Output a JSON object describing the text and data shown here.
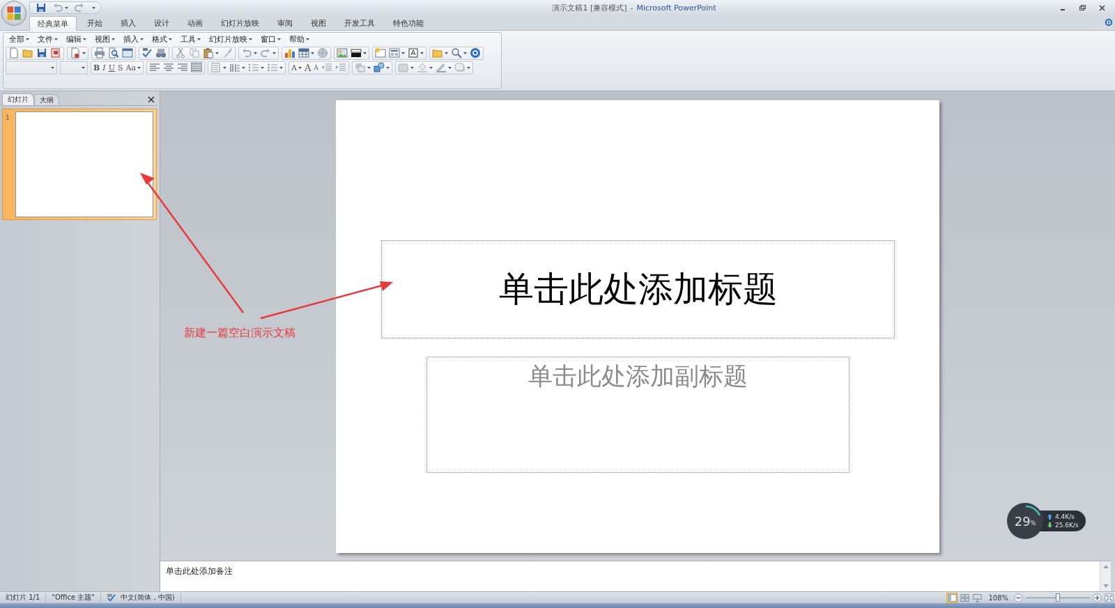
{
  "window": {
    "title": "演示文稿1 [兼容模式]",
    "separator": "-",
    "app": "Microsoft PowerPoint"
  },
  "ribbon_tabs": [
    {
      "label": "经典菜单",
      "selected": true
    },
    {
      "label": "开始",
      "selected": false
    },
    {
      "label": "插入",
      "selected": false
    },
    {
      "label": "设计",
      "selected": false
    },
    {
      "label": "动画",
      "selected": false
    },
    {
      "label": "幻灯片放映",
      "selected": false
    },
    {
      "label": "审阅",
      "selected": false
    },
    {
      "label": "视图",
      "selected": false
    },
    {
      "label": "开发工具",
      "selected": false
    },
    {
      "label": "特色功能",
      "selected": false
    }
  ],
  "menu_bar": [
    "全部",
    "文件",
    "编辑",
    "视图",
    "插入",
    "格式",
    "工具",
    "幻灯片放映",
    "窗口",
    "帮助"
  ],
  "format_buttons": [
    "B",
    "I",
    "U",
    "S",
    "Aa"
  ],
  "font_buttons": [
    "A",
    "A",
    "A"
  ],
  "left_pane": {
    "tabs": [
      {
        "label": "幻灯片",
        "selected": true
      },
      {
        "label": "大纲",
        "selected": false
      }
    ],
    "slides": [
      {
        "number": "1",
        "selected": true
      }
    ]
  },
  "slide": {
    "title_placeholder": "单击此处添加标题",
    "subtitle_placeholder": "单击此处添加副标题"
  },
  "annotation": {
    "text": "新建一篇空白演示文稿"
  },
  "notes": {
    "prompt": "单击此处添加备注"
  },
  "status_bar": {
    "slide_info": "幻灯片 1/1",
    "theme": "\"Office 主题\"",
    "language": "中文(简体，中国)",
    "views": [
      {
        "kind": "normal",
        "selected": true
      },
      {
        "kind": "sorter",
        "selected": false
      },
      {
        "kind": "show",
        "selected": false
      }
    ],
    "zoom": "108%",
    "level": 0.5
  },
  "network_widget": {
    "cpu": "29",
    "unit": "%",
    "upload": "4.4K/s",
    "download": "25.6K/s"
  }
}
